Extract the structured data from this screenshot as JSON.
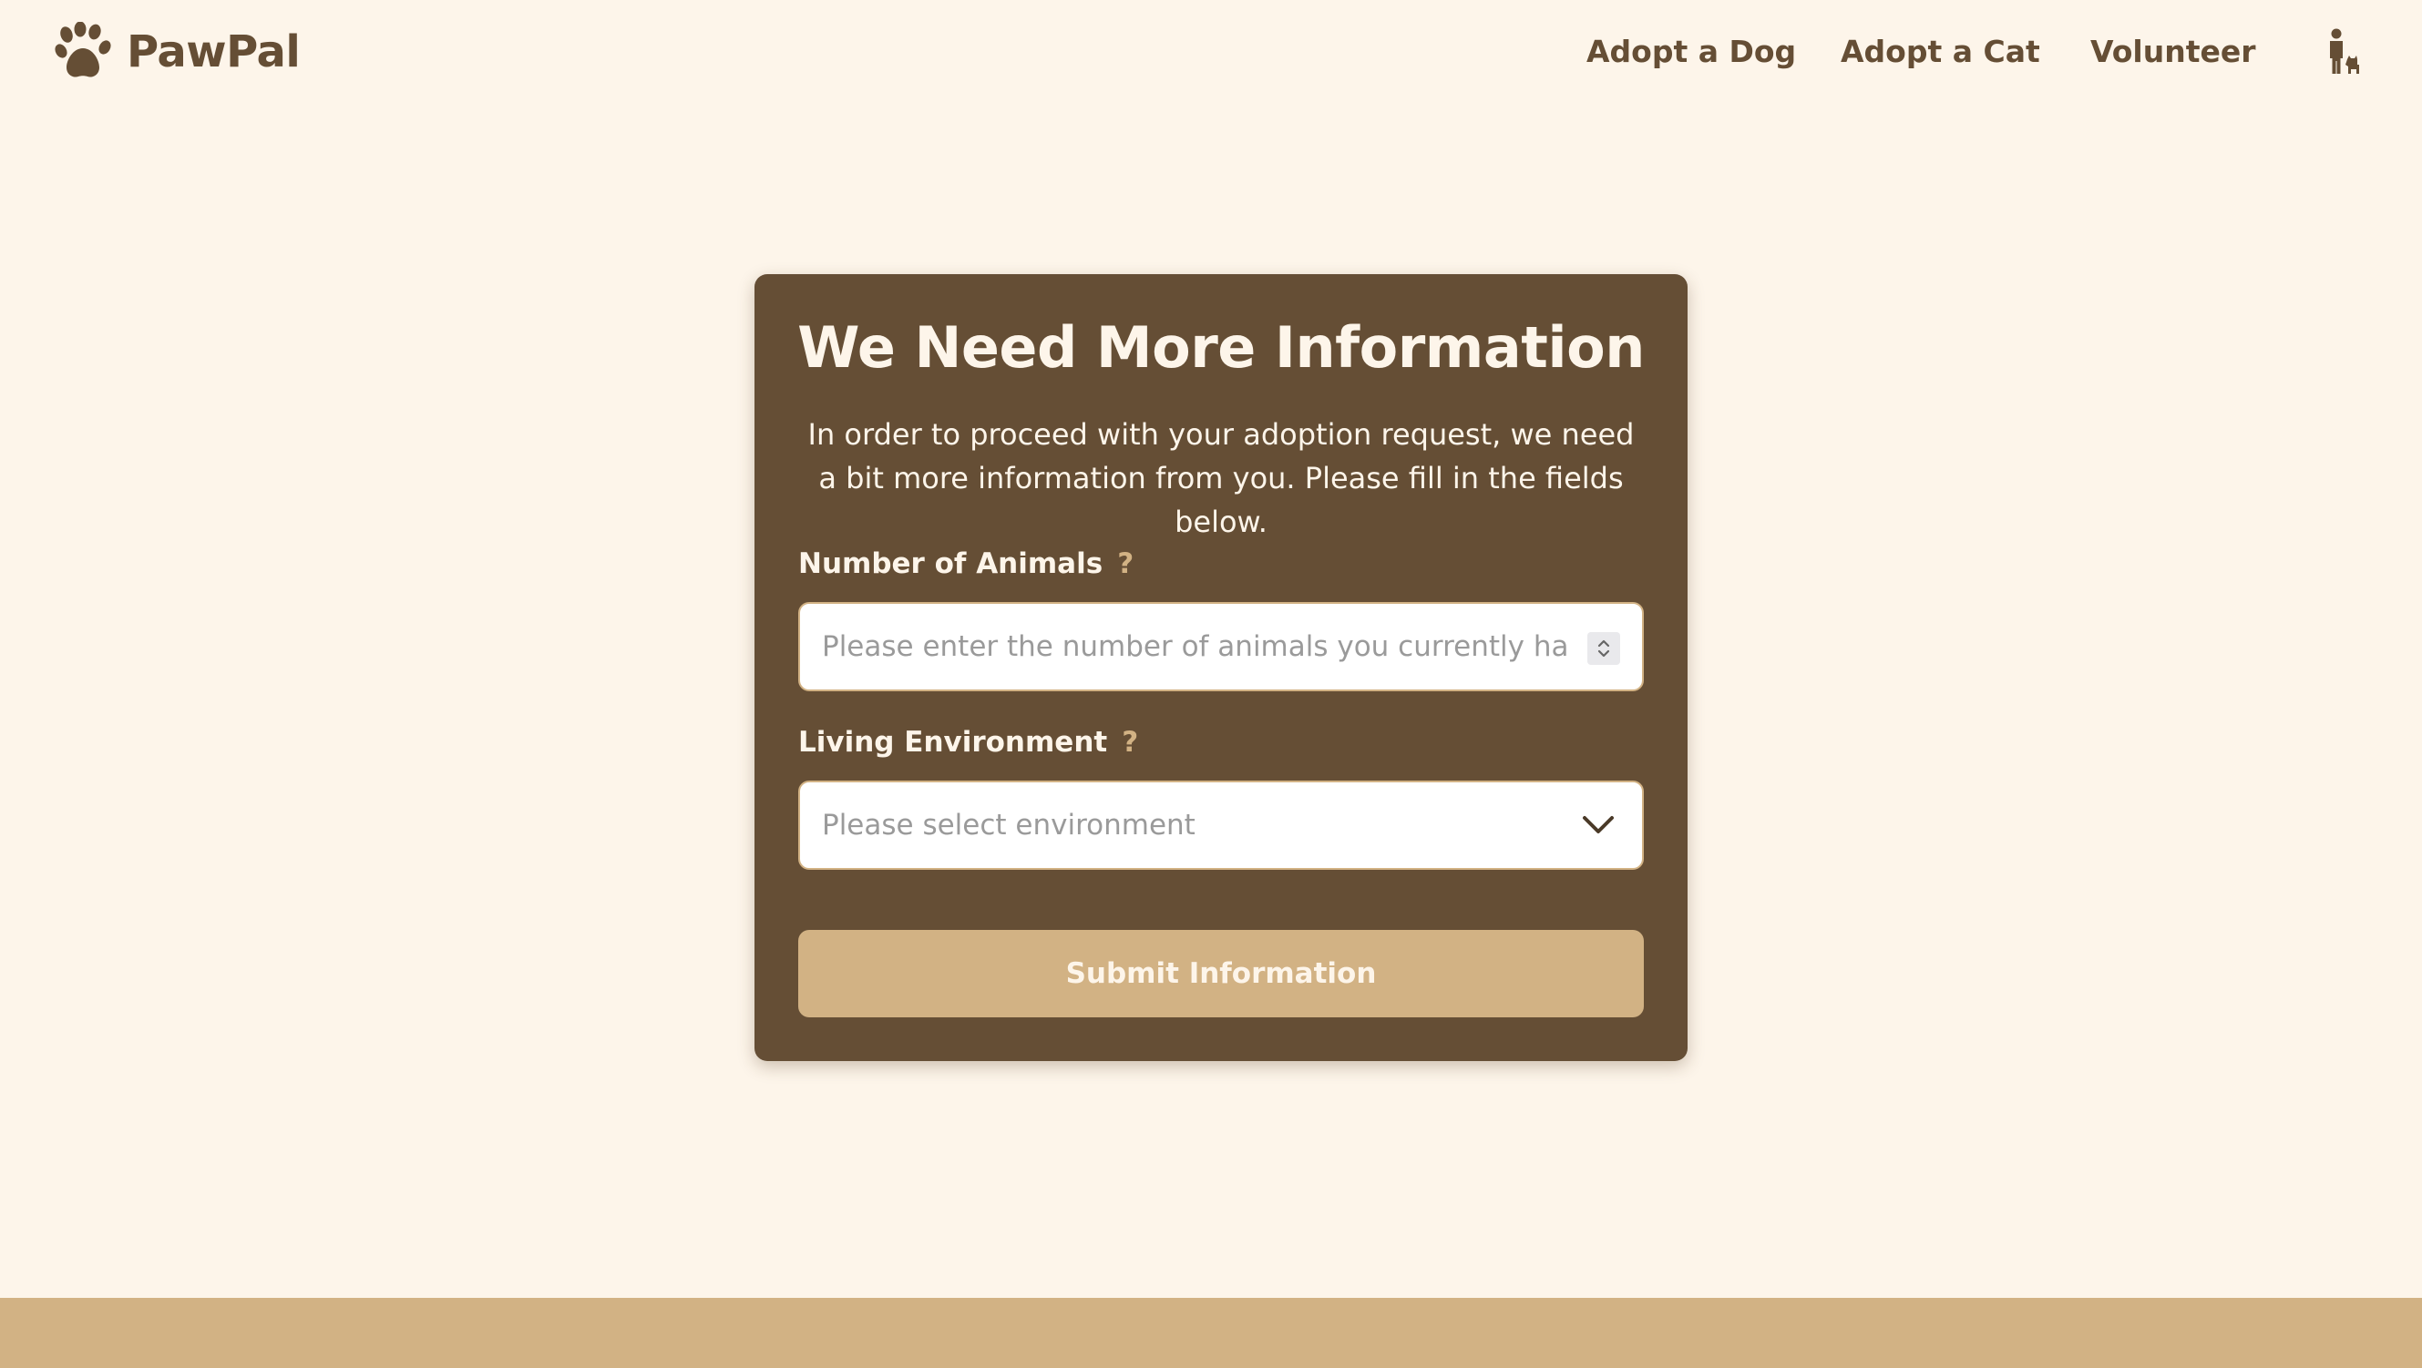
{
  "header": {
    "brand": "PawPal",
    "logo_icon": "paw-icon",
    "nav": [
      {
        "label": "Adopt a Dog"
      },
      {
        "label": "Adopt a Cat"
      },
      {
        "label": "Volunteer"
      }
    ],
    "profile_icon": "person-with-dog-icon"
  },
  "form": {
    "title": "We Need More Information",
    "description": "In order to proceed with your adoption request, we need a bit more information from you. Please fill in the fields below.",
    "fields": [
      {
        "label": "Number of Animals",
        "help": "?",
        "type": "number",
        "value": "",
        "placeholder": "Please enter the number of animals you currently have"
      },
      {
        "label": "Living Environment",
        "help": "?",
        "type": "select",
        "selected": "Please select environment"
      }
    ],
    "submit_label": "Submit Information"
  },
  "colors": {
    "page_background": "#fdf5ea",
    "card_background": "#654e35",
    "accent": "#d2b284",
    "text_dark": "#654e35",
    "text_light": "#fdf5ea"
  }
}
